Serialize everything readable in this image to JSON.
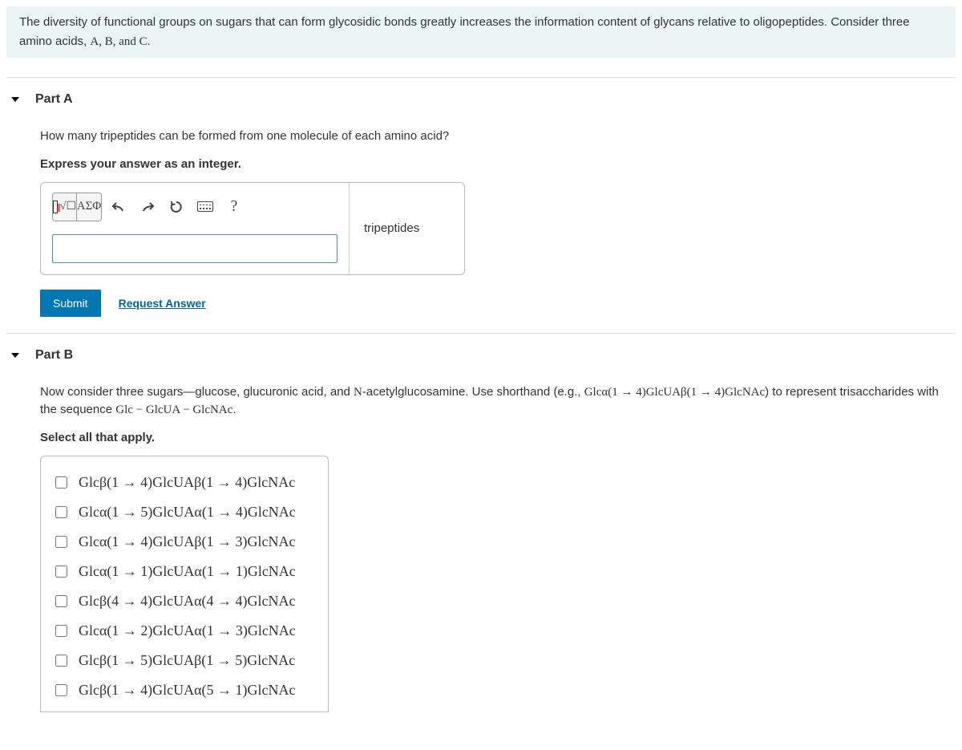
{
  "intro": {
    "text_before": "The diversity of functional groups on sugars that can form glycosidic bonds greatly increases the information content of glycans relative to oligopeptides. Consider three amino acids, ",
    "letters": "A, B, and C.",
    "text_after": ""
  },
  "partA": {
    "title": "Part A",
    "prompt": "How many tripeptides can be formed from one molecule of each amino acid?",
    "instruction": "Express your answer as an integer.",
    "toolbar": {
      "template_label": "",
      "greek_label": "ΑΣΦ",
      "help_label": "?"
    },
    "input_value": "",
    "unit": "tripeptides",
    "submit_label": "Submit",
    "request_label": "Request Answer"
  },
  "partB": {
    "title": "Part B",
    "prompt_before": "Now consider three sugars—glucose, glucuronic acid, and ",
    "nacetyl": "N",
    "prompt_mid1": "-acetylglucosamine. Use shorthand (e.g., ",
    "example": "Glcα(1 → 4)GlcUAβ(1 → 4)GlcNAc",
    "prompt_mid2": ") to represent trisaccharides with the sequence ",
    "sequence": "Glc − GlcUA − GlcNAc",
    "prompt_after": ".",
    "instruction": "Select all that apply.",
    "options": [
      "Glcβ(1 → 4)GlcUAβ(1 → 4)GlcNAc",
      "Glcα(1 → 5)GlcUAα(1 → 4)GlcNAc",
      "Glcα(1 → 4)GlcUAβ(1 → 3)GlcNAc",
      "Glcα(1 → 1)GlcUAα(1 → 1)GlcNAc",
      "Glcβ(4 → 4)GlcUAα(4 → 4)GlcNAc",
      "Glcα(1 → 2)GlcUAα(1 → 3)GlcNAc",
      "Glcβ(1 → 5)GlcUAβ(1 → 5)GlcNAc",
      "Glcβ(1 → 4)GlcUAα(5 → 1)GlcNAc"
    ]
  }
}
